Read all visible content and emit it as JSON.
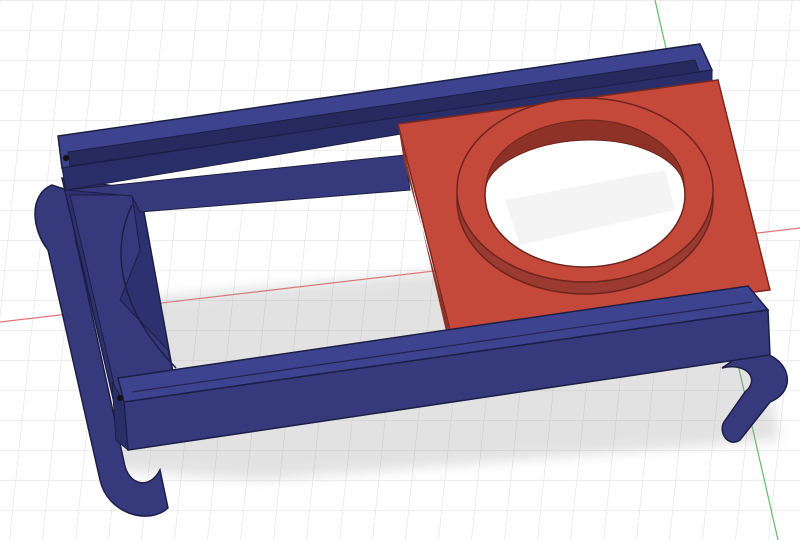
{
  "viewport": {
    "grid": "on",
    "background": "#ffffff",
    "grid_color": "#dcdcdc",
    "axis_x_color": "#e57373",
    "axis_y_color": "#66bb6a"
  },
  "model": {
    "frame_color": "#363a7c",
    "frame_top_color": "#3e438f",
    "frame_dark_color": "#23264f",
    "plate_color": "#c4493a",
    "plate_dark_color": "#8e3126",
    "ring_color": "#b7433a"
  }
}
